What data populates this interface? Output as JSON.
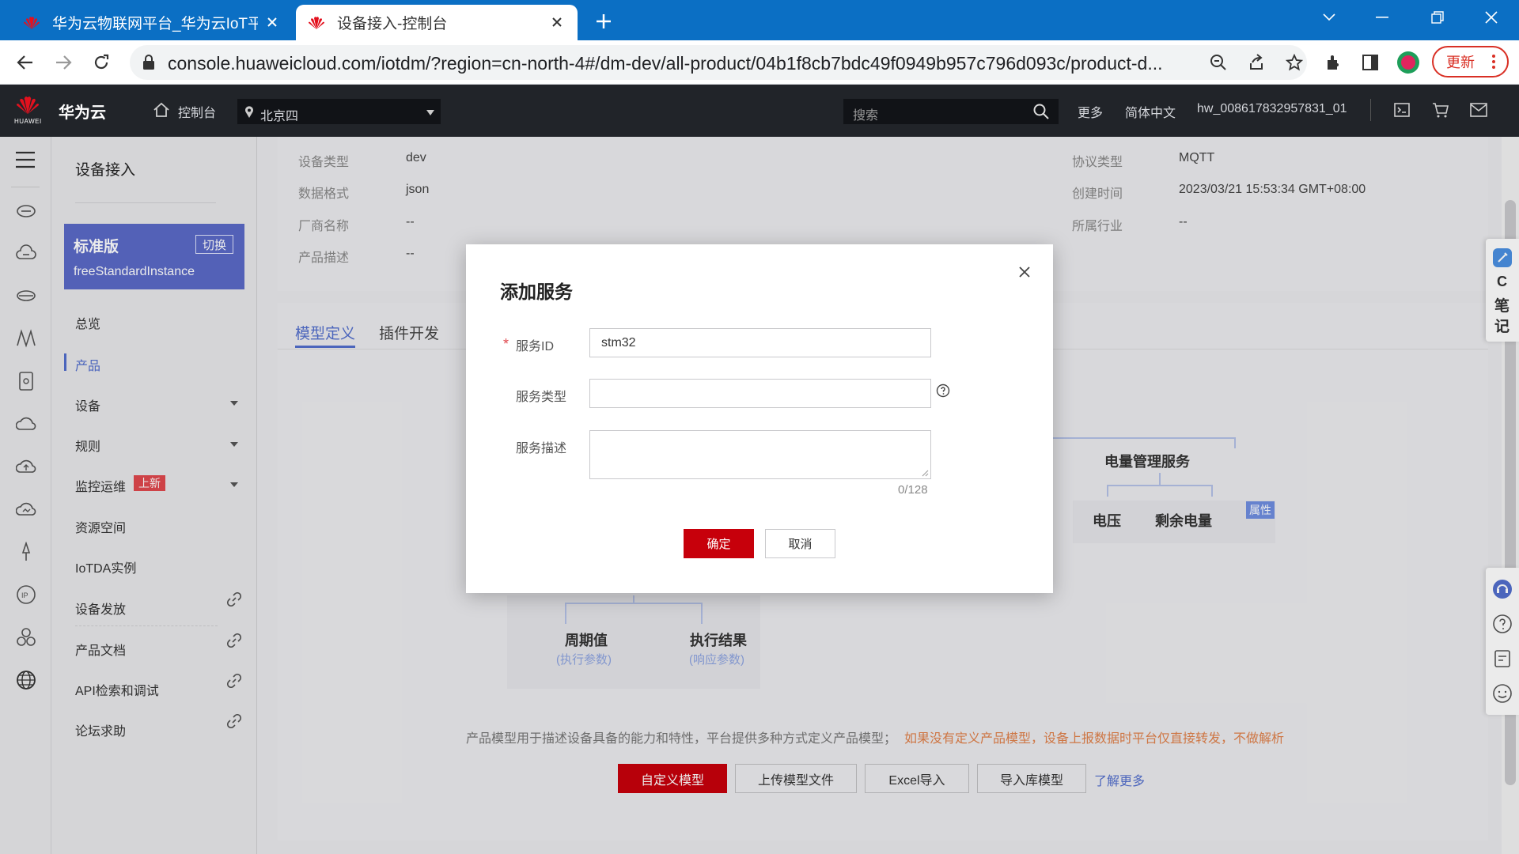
{
  "browser": {
    "tabs": [
      {
        "title": "华为云物联网平台_华为云IoT平台",
        "active": false
      },
      {
        "title": "设备接入-控制台",
        "active": true
      }
    ],
    "url": "console.huaweicloud.com/iotdm/?region=cn-north-4#/dm-dev/all-product/04b1f8cb7bdc49f0949b957c796d093c/product-d...",
    "update_label": "更新"
  },
  "header": {
    "brand": "华为云",
    "logo_text": "HUAWEI",
    "console_label": "控制台",
    "region": "北京四",
    "search_placeholder": "搜索",
    "more": "更多",
    "language": "简体中文",
    "username": "hw_008617832957831_01"
  },
  "sidebar": {
    "title": "设备接入",
    "edition": {
      "name": "标准版",
      "switch_label": "切换",
      "instance": "freeStandardInstance"
    },
    "items": [
      {
        "label": "总览"
      },
      {
        "label": "产品",
        "active": true
      },
      {
        "label": "设备"
      },
      {
        "label": "规则"
      },
      {
        "label": "监控运维",
        "badge": "上新"
      },
      {
        "label": "资源空间"
      },
      {
        "label": "IoTDA实例"
      },
      {
        "label": "设备发放"
      },
      {
        "label": "产品文档"
      },
      {
        "label": "API检索和调试"
      },
      {
        "label": "论坛求助"
      }
    ]
  },
  "product_info": {
    "device_type_label": "设备类型",
    "device_type": "dev",
    "data_format_label": "数据格式",
    "data_format": "json",
    "vendor_label": "厂商名称",
    "vendor": "--",
    "description_label": "产品描述",
    "description": "--",
    "protocol_label": "协议类型",
    "protocol": "MQTT",
    "created_label": "创建时间",
    "created": "2023/03/21 15:53:34 GMT+08:00",
    "industry_label": "所属行业",
    "industry": "--"
  },
  "tabs": {
    "model": "模型定义",
    "plugin": "插件开发"
  },
  "diagram": {
    "power_service": "电量管理服务",
    "voltage": "电压",
    "remaining": "剩余电量",
    "property_tag": "属性",
    "period": "周期值",
    "period_sub": "(执行参数)",
    "result": "执行结果",
    "result_sub": "(响应参数)"
  },
  "model_hint": {
    "text": "产品模型用于描述设备具备的能力和特性，平台提供多种方式定义产品模型；",
    "warning": "如果没有定义产品模型，设备上报数据时平台仅直接转发，不做解析"
  },
  "model_buttons": {
    "custom": "自定义模型",
    "upload": "上传模型文件",
    "excel": "Excel导入",
    "import_lib": "导入库模型",
    "learn_more": "了解更多"
  },
  "modal": {
    "title": "添加服务",
    "service_id_label": "服务ID",
    "service_id_value": "stm32",
    "service_type_label": "服务类型",
    "service_type_value": "",
    "service_desc_label": "服务描述",
    "service_desc_value": "",
    "char_count": "0/128",
    "confirm": "确定",
    "cancel": "取消"
  },
  "float_note": {
    "c": "C",
    "label1": "笔",
    "label2": "记"
  },
  "colors": {
    "brand_red": "#c7000b",
    "accent_blue": "#526ecc",
    "edition_card": "#5b6ac7",
    "header_bg": "#212429",
    "tab_bar": "#0b6fc4"
  }
}
